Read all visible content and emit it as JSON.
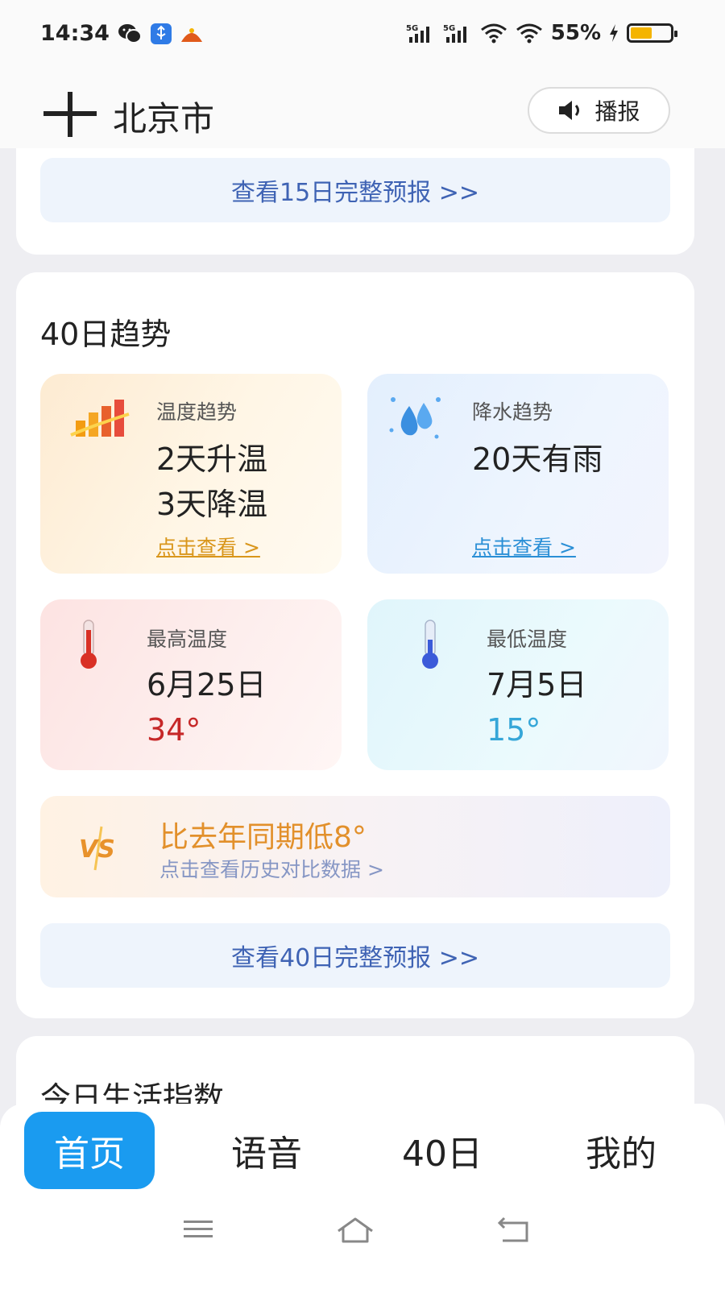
{
  "status_bar": {
    "time": "14:34",
    "battery_percent": "55%",
    "battery_level": 0.55,
    "icons": [
      "wechat-icon",
      "usb-icon",
      "app-icon",
      "5g-signal-icon",
      "5g-signal-icon",
      "wifi-icon",
      "wifi-icon",
      "charging-icon"
    ]
  },
  "header": {
    "city": "北京市",
    "broadcast_label": "播报",
    "add_icon": "plus-icon",
    "speaker_icon": "speaker-icon"
  },
  "forecast15": {
    "link": "查看15日完整预报 >>"
  },
  "trend40": {
    "title": "40日趋势",
    "temp_trend": {
      "label": "温度趋势",
      "line1": "2天升温",
      "line2": "3天降温",
      "link": "点击查看 >",
      "link_color": "#d9961b"
    },
    "rain_trend": {
      "label": "降水趋势",
      "value": "20天有雨",
      "link": "点击查看 >",
      "link_color": "#2a8fd6"
    },
    "max_temp": {
      "label": "最高温度",
      "date": "6月25日",
      "temp": "34°",
      "color": "#c62828"
    },
    "min_temp": {
      "label": "最低温度",
      "date": "7月5日",
      "temp": "15°",
      "color": "#35a6d8"
    },
    "compare": {
      "main": "比去年同期低8°",
      "sub": "点击查看历史对比数据 >"
    },
    "full_link": "查看40日完整预报 >>"
  },
  "life_index": {
    "title": "今日生活指数"
  },
  "bottom_nav": {
    "tabs": [
      {
        "label": "首页",
        "active": true
      },
      {
        "label": "语音",
        "active": false
      },
      {
        "label": "40日",
        "active": false
      },
      {
        "label": "我的",
        "active": false
      }
    ]
  },
  "colors": {
    "accent": "#1a9bf0",
    "link_blue": "#3f63b4"
  }
}
